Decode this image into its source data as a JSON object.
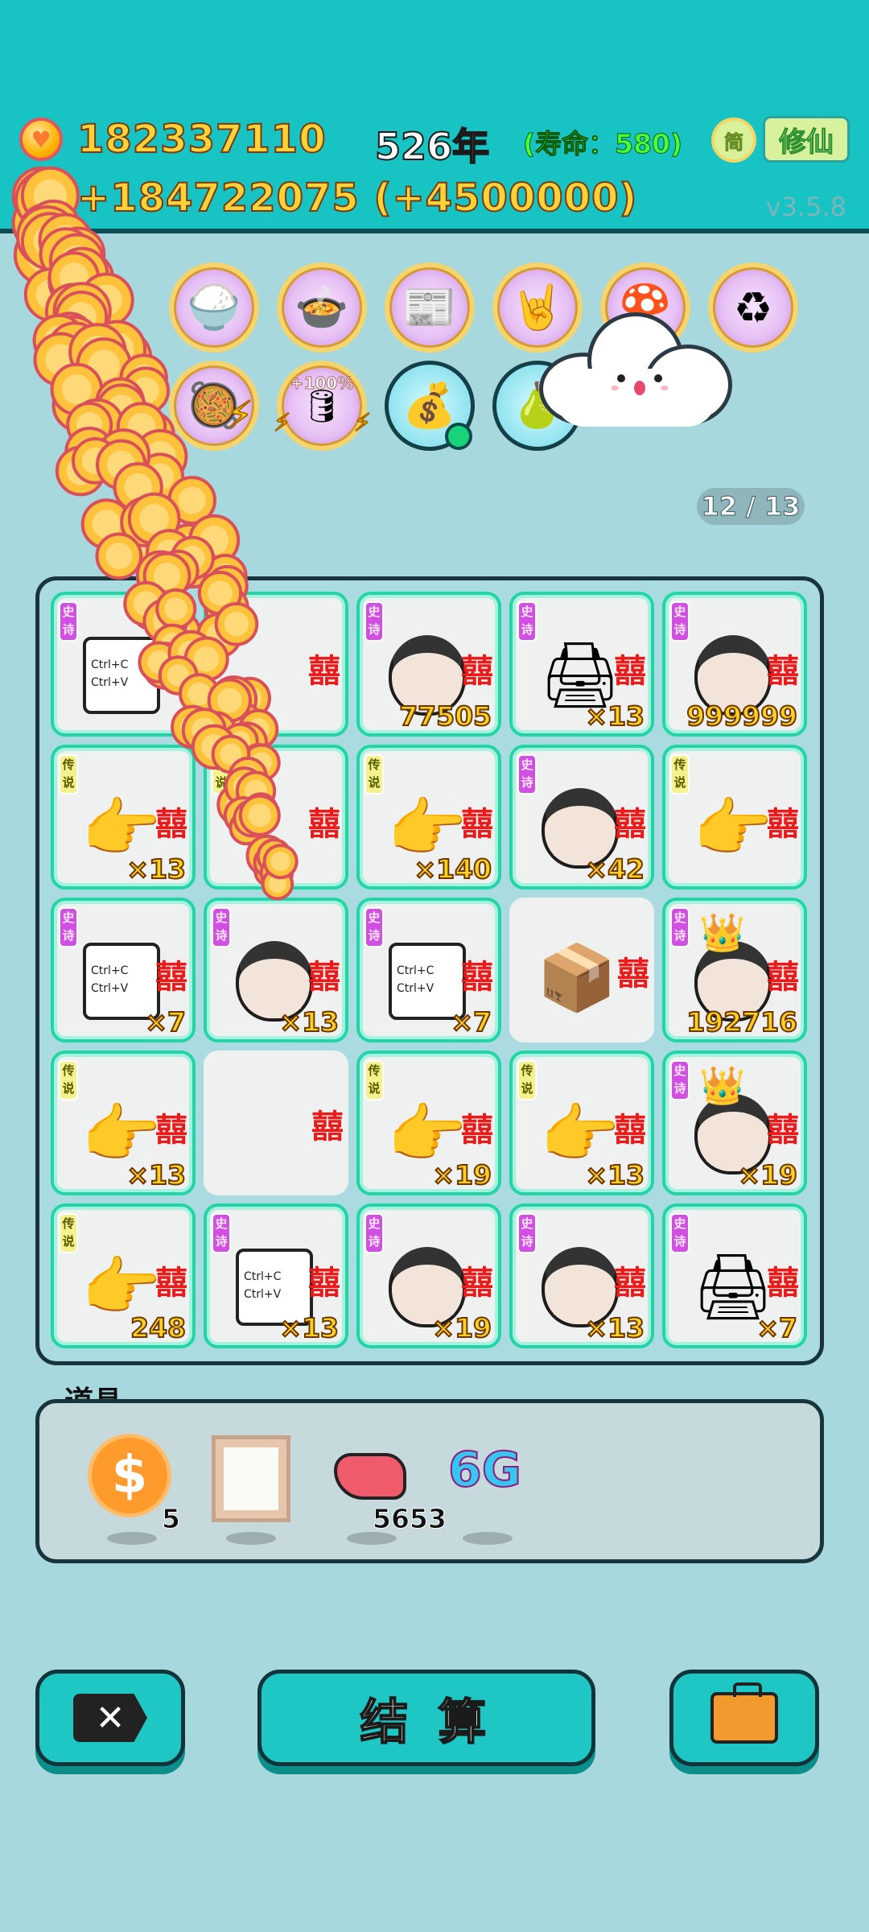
{
  "header": {
    "money": "182337110",
    "income": "+184722075 (+4500000)",
    "year": "526年",
    "lifespan": "(寿命：580)",
    "simplified_button": "简",
    "xiuxian_button": "修仙",
    "version": "v3.5.8"
  },
  "upgrades": {
    "row1": [
      "rice-bowls-icon",
      "rice-cooker-icon",
      "time-magazine-icon",
      "rock-hand-icon",
      "mushroom-icon",
      "recycle-icon"
    ],
    "row2": [
      "pot-icon",
      "rice-bag-icon",
      "money-bag-icon",
      "pear-icon"
    ],
    "row2_bonus": "+100%"
  },
  "page_indicator": "12 / 13",
  "board": {
    "epic_tag": "史诗",
    "legend_tag": "传说",
    "xi_mark": "囍",
    "cells": [
      {
        "type": "ctrl",
        "rarity": "epic",
        "count": ""
      },
      {
        "type": "hidden",
        "rarity": "epic",
        "count": ""
      },
      {
        "type": "face",
        "rarity": "epic",
        "count": "77505"
      },
      {
        "type": "printer",
        "rarity": "epic",
        "count": "×13"
      },
      {
        "type": "face",
        "rarity": "epic",
        "count": "999999"
      },
      {
        "type": "hand",
        "rarity": "legend",
        "count": "×13"
      },
      {
        "type": "hidden",
        "rarity": "legend",
        "count": ""
      },
      {
        "type": "hand",
        "rarity": "legend",
        "count": "×140"
      },
      {
        "type": "face",
        "rarity": "epic",
        "count": "×42"
      },
      {
        "type": "hand",
        "rarity": "legend",
        "count": ""
      },
      {
        "type": "ctrl",
        "rarity": "epic",
        "count": "×7"
      },
      {
        "type": "face",
        "rarity": "epic",
        "count": "×13"
      },
      {
        "type": "ctrl",
        "rarity": "epic",
        "count": "×7"
      },
      {
        "type": "box",
        "rarity": "none",
        "count": ""
      },
      {
        "type": "king",
        "rarity": "epic",
        "count": "192716"
      },
      {
        "type": "hand",
        "rarity": "legend",
        "count": "×13"
      },
      {
        "type": "empty",
        "rarity": "none",
        "count": ""
      },
      {
        "type": "hand",
        "rarity": "legend",
        "count": "×19"
      },
      {
        "type": "hand",
        "rarity": "legend",
        "count": "×13"
      },
      {
        "type": "king",
        "rarity": "epic",
        "count": "×19"
      },
      {
        "type": "hand",
        "rarity": "legend",
        "count": "248"
      },
      {
        "type": "ctrl",
        "rarity": "epic",
        "count": "×13"
      },
      {
        "type": "face",
        "rarity": "epic",
        "count": "×19"
      },
      {
        "type": "face",
        "rarity": "epic",
        "count": "×13"
      },
      {
        "type": "printer",
        "rarity": "epic",
        "count": "×7"
      }
    ],
    "ctrl_text": "Ctrl+C Ctrl+V"
  },
  "tools": {
    "label": "道具",
    "dollar_count": "5",
    "liver_count": "5653",
    "network_label": "6G"
  },
  "buttons": {
    "settle": "结 算"
  },
  "colors": {
    "header_bg": "#17c3c3",
    "page_bg": "#a6d8de",
    "coin_gold": "#ffb300",
    "glow_border": "#20d6a6"
  }
}
